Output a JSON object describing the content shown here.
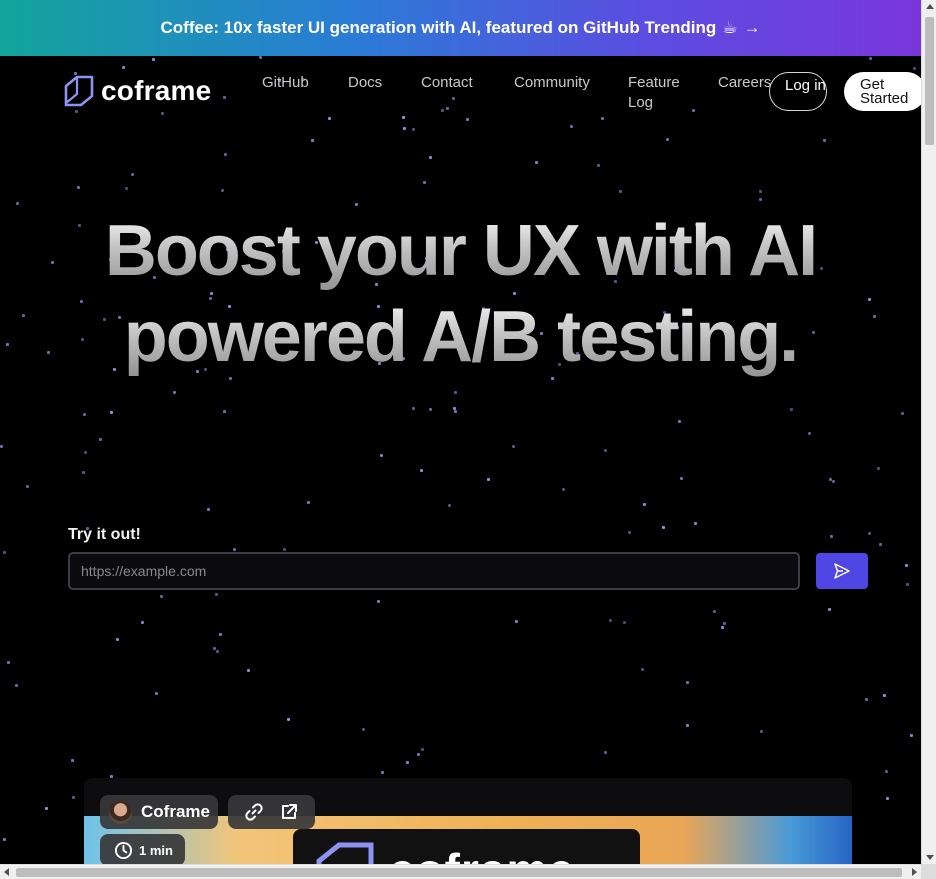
{
  "banner": {
    "text": "Coffee: 10x faster UI generation with AI, featured on GitHub Trending",
    "emoji": "☕",
    "arrow": "→"
  },
  "nav": {
    "logo_text": "coframe",
    "links": [
      "GitHub",
      "Docs",
      "Contact",
      "Community",
      "Feature Log",
      "Careers"
    ],
    "login_label": "Log in",
    "get_started_label": "Get Started"
  },
  "hero": {
    "line1": "Boost your UX with AI",
    "line2": "powered A/B testing."
  },
  "try": {
    "label": "Try it out!",
    "placeholder": "https://example.com",
    "value": ""
  },
  "preview": {
    "brand_label": "Coframe",
    "duration_label": "1 min",
    "image_text": "coframe"
  },
  "icons": {
    "logo": "coframe-logo-icon",
    "send": "send-icon",
    "link": "link-icon",
    "external": "external-link-icon",
    "clock": "clock-icon",
    "avatar": "avatar"
  },
  "colors": {
    "banner_gradient_start": "#13a59c",
    "banner_gradient_end": "#7a36dc",
    "accent": "#5046e4",
    "background": "#000000",
    "star": "#8d95e6"
  }
}
